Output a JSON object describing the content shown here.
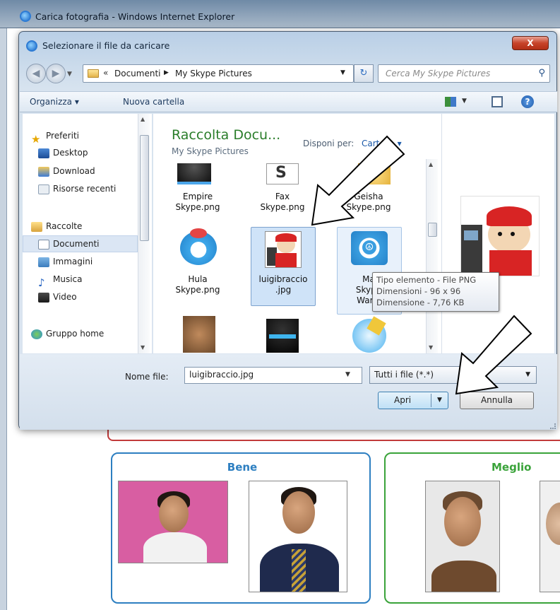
{
  "browser": {
    "title": "Carica fotografia - Windows Internet Explorer"
  },
  "dialog": {
    "title": "Selezionare il file da caricare",
    "close_label": "X",
    "breadcrumb": {
      "prefix": "«",
      "path": [
        "Documenti",
        "My Skype Pictures"
      ]
    },
    "search_placeholder": "Cerca My Skype Pictures",
    "toolbar": {
      "organize": "Organizza ▾",
      "new_folder": "Nuova cartella"
    },
    "nav": {
      "favorites": [
        {
          "label": "Preferiti",
          "icon": "star-icon"
        },
        {
          "label": "Desktop",
          "icon": "desktop-icon"
        },
        {
          "label": "Download",
          "icon": "download-icon"
        },
        {
          "label": "Risorse recenti",
          "icon": "recent-icon"
        }
      ],
      "libraries": [
        {
          "label": "Raccolte",
          "icon": "library-icon"
        },
        {
          "label": "Documenti",
          "icon": "documents-icon",
          "selected": true
        },
        {
          "label": "Immagini",
          "icon": "pictures-icon"
        },
        {
          "label": "Musica",
          "icon": "music-icon"
        },
        {
          "label": "Video",
          "icon": "video-icon"
        }
      ],
      "homegroup": {
        "label": "Gruppo home",
        "icon": "homegroup-icon"
      }
    },
    "library": {
      "title": "Raccolta Docu...",
      "subtitle": "My Skype Pictures",
      "arrange_label": "Disponi per:",
      "arrange_value": "Cartella ▾"
    },
    "files": [
      {
        "line1": "Empire",
        "line2": "Skype.png"
      },
      {
        "line1": "Fax",
        "line2": "Skype.png"
      },
      {
        "line1": "Geisha",
        "line2": "Skype.png"
      },
      {
        "line1": "Hula",
        "line2": "Skype.png"
      },
      {
        "line1": "luigibraccio",
        "line2": ".jpg",
        "selected": true
      },
      {
        "line1": "Ma",
        "line2": "Skype",
        "line3": "War..."
      }
    ],
    "tooltip": {
      "line1": "Tipo elemento - File PNG",
      "line2": "Dimensioni - 96 x 96",
      "line3": "Dimensione - 7,76 KB"
    },
    "filename_label": "Nome file:",
    "filename_value": "luigibraccio.jpg",
    "filetype_value": "Tutti i file (*.*)",
    "open_label": "Apri",
    "cancel_label": "Annulla"
  },
  "webpage": {
    "bene_title": "Bene",
    "meglio_title": "Meglio",
    "bene_color": "#2d7fc1",
    "meglio_color": "#3aa33a"
  }
}
